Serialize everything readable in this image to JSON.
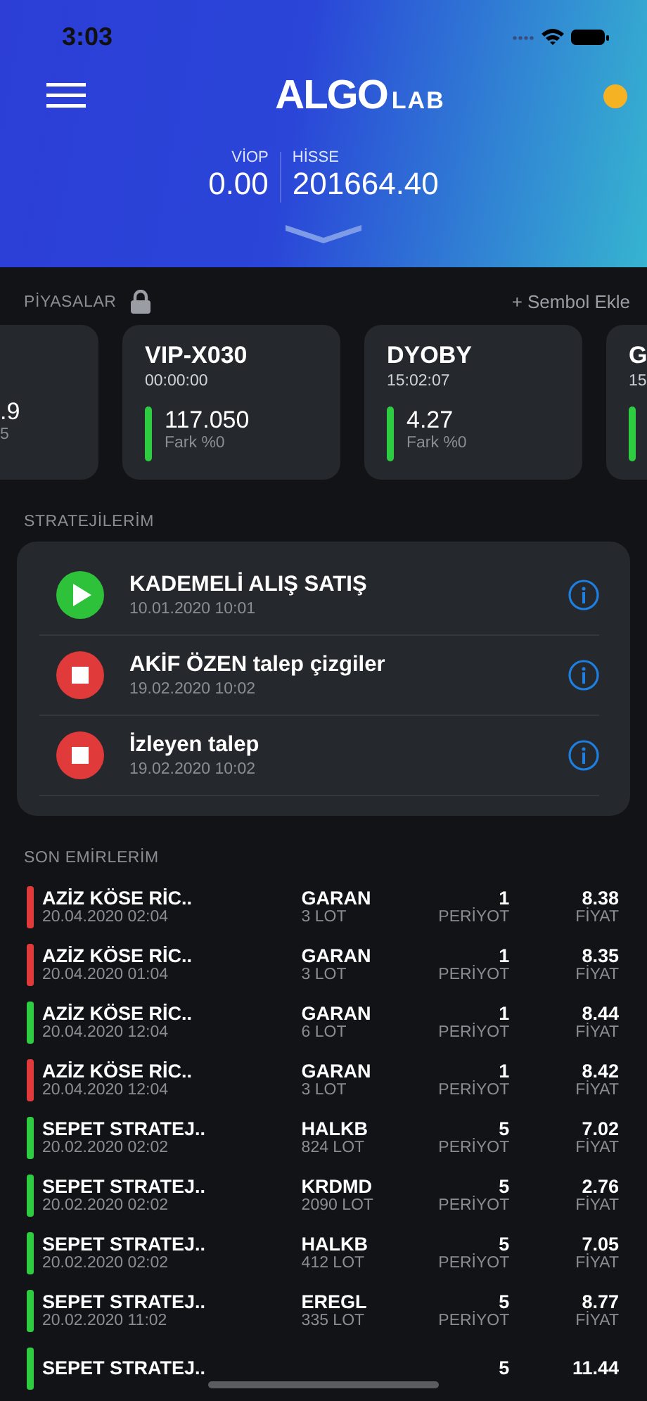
{
  "status_bar": {
    "time": "3:03"
  },
  "header": {
    "logo_main": "ALGO",
    "logo_sub": "LAB",
    "notification_dot": {
      "color": "#f5b324"
    },
    "balances": [
      {
        "label": "VİOP",
        "value": "0.00"
      },
      {
        "label": "HİSSE",
        "value": "201664.40"
      }
    ]
  },
  "markets": {
    "title": "PİYASALAR",
    "add_label": "+ Sembol Ekle",
    "cards": [
      {
        "kind": "cut_left",
        "value": ".9",
        "diff": "5"
      },
      {
        "kind": "full",
        "name": "VIP-X030",
        "time": "00:00:00",
        "value": "117.050",
        "diff": "Fark %0",
        "color": "#2ecc40"
      },
      {
        "kind": "full",
        "name": "DYOBY",
        "time": "15:02:07",
        "value": "4.27",
        "diff": "Fark %0",
        "color": "#2ecc40"
      },
      {
        "kind": "cut_right",
        "name": "G",
        "time": "15",
        "color": "#2ecc40"
      }
    ]
  },
  "strategies": {
    "title": "STRATEJİLERİM",
    "items": [
      {
        "name": "KADEMELİ ALIŞ SATIŞ",
        "date": "10.01.2020 10:01",
        "running": true
      },
      {
        "name": "AKİF ÖZEN talep çizgiler",
        "date": "19.02.2020 10:02",
        "running": false
      },
      {
        "name": "İzleyen talep",
        "date": "19.02.2020 10:02",
        "running": false
      }
    ]
  },
  "orders": {
    "title": "SON EMİRLERİM",
    "rows": [
      {
        "name": "AZİZ KÖSE RİC..",
        "date": "20.04.2020 02:04",
        "symbol": "GARAN",
        "lot": "3 LOT",
        "period": "1",
        "period_label": "PERİYOT",
        "price": "8.38",
        "price_label": "FİYAT",
        "color": "#e03a3a"
      },
      {
        "name": "AZİZ KÖSE RİC..",
        "date": "20.04.2020 01:04",
        "symbol": "GARAN",
        "lot": "3 LOT",
        "period": "1",
        "period_label": "PERİYOT",
        "price": "8.35",
        "price_label": "FİYAT",
        "color": "#e03a3a"
      },
      {
        "name": "AZİZ KÖSE RİC..",
        "date": "20.04.2020 12:04",
        "symbol": "GARAN",
        "lot": "6 LOT",
        "period": "1",
        "period_label": "PERİYOT",
        "price": "8.44",
        "price_label": "FİYAT",
        "color": "#2ecc40"
      },
      {
        "name": "AZİZ KÖSE RİC..",
        "date": "20.04.2020 12:04",
        "symbol": "GARAN",
        "lot": "3 LOT",
        "period": "1",
        "period_label": "PERİYOT",
        "price": "8.42",
        "price_label": "FİYAT",
        "color": "#e03a3a"
      },
      {
        "name": "SEPET STRATEJ..",
        "date": "20.02.2020 02:02",
        "symbol": "HALKB",
        "lot": "824 LOT",
        "period": "5",
        "period_label": "PERİYOT",
        "price": "7.02",
        "price_label": "FİYAT",
        "color": "#2ecc40"
      },
      {
        "name": "SEPET STRATEJ..",
        "date": "20.02.2020 02:02",
        "symbol": "KRDMD",
        "lot": "2090 LOT",
        "period": "5",
        "period_label": "PERİYOT",
        "price": "2.76",
        "price_label": "FİYAT",
        "color": "#2ecc40"
      },
      {
        "name": "SEPET STRATEJ..",
        "date": "20.02.2020 02:02",
        "symbol": "HALKB",
        "lot": "412 LOT",
        "period": "5",
        "period_label": "PERİYOT",
        "price": "7.05",
        "price_label": "FİYAT",
        "color": "#2ecc40"
      },
      {
        "name": "SEPET STRATEJ..",
        "date": "20.02.2020 11:02",
        "symbol": "EREGL",
        "lot": "335 LOT",
        "period": "5",
        "period_label": "PERİYOT",
        "price": "8.77",
        "price_label": "FİYAT",
        "color": "#2ecc40"
      },
      {
        "name": "SEPET STRATEJ..",
        "period": "5",
        "price": "11.44",
        "color": "#2ecc40"
      }
    ]
  }
}
